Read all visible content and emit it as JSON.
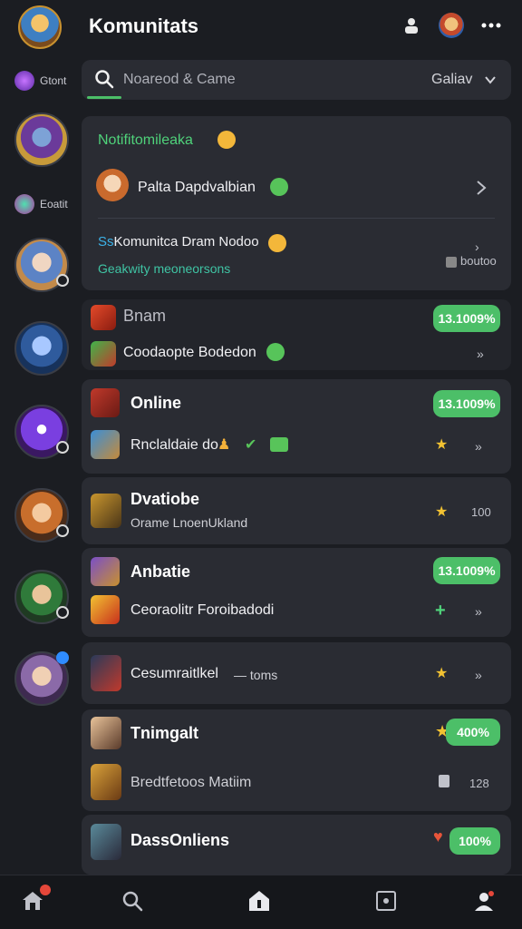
{
  "header": {
    "title": "Komunitats"
  },
  "rail": {
    "labels": [
      "Gtont",
      "Eoatit"
    ]
  },
  "search": {
    "placeholder": "Noareod & Came",
    "filter": "Galiav"
  },
  "notifications": {
    "title": "Notifitomileaka",
    "item1": "Palta Dapdvalbian",
    "item2": "Komunitca Dram Nodoo",
    "item2_prefix": "Ss",
    "item2_sub": "Geakwity meoneorsons",
    "item2_action": "boutoo"
  },
  "cards": [
    {
      "title": "Bnam",
      "badge": "13.1009%",
      "row": "Coodaopte Bodedon",
      "action": "»"
    },
    {
      "title": "Online",
      "badge": "13.1009%",
      "row": "Rnclaldaie do",
      "action": "»"
    },
    {
      "title": "Dvatiobe",
      "row": "Orame LnoenUkland",
      "count": "100"
    },
    {
      "title": "Anbatie",
      "badge": "13.1009%",
      "row": "Ceoraolitr Foroibadodi",
      "action": "»"
    },
    {
      "title": "Cesumraitlkel",
      "suffix": "— toms",
      "action": "»"
    },
    {
      "title": "Tnimgalt",
      "badge": "400%",
      "row": "Bredtfetoos Matiim",
      "count": "128"
    },
    {
      "title": "DassOnliens",
      "badge": "100%"
    }
  ],
  "colors": {
    "background": "#1b1d22",
    "card": "#2a2c33",
    "accent_green": "#4cbf68",
    "star": "#f2c232",
    "notification_green": "#4fd27a"
  },
  "icons": {
    "header": [
      "person-icon",
      "user-avatar",
      "more-icon"
    ],
    "tabbar": [
      "home-icon",
      "search-icon",
      "home-icon",
      "puzzle-icon",
      "profile-icon"
    ]
  }
}
